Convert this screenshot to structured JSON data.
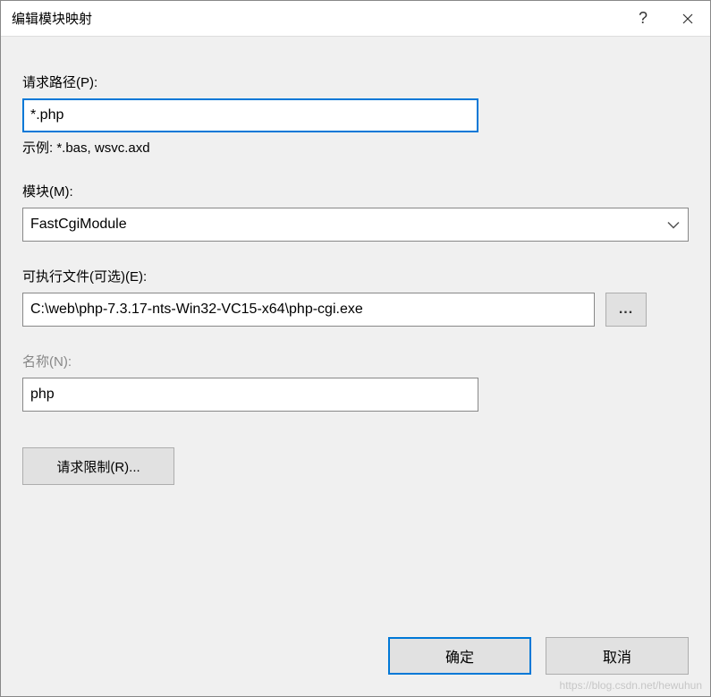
{
  "dialog": {
    "title": "编辑模块映射",
    "help_symbol": "?",
    "close_symbol": "✕"
  },
  "fields": {
    "request_path": {
      "label": "请求路径(P):",
      "value": "*.php",
      "hint": "示例: *.bas, wsvc.axd"
    },
    "module": {
      "label": "模块(M):",
      "value": "FastCgiModule"
    },
    "executable": {
      "label": "可执行文件(可选)(E):",
      "value": "C:\\web\\php-7.3.17-nts-Win32-VC15-x64\\php-cgi.exe",
      "browse_label": "..."
    },
    "name": {
      "label": "名称(N):",
      "value": "php"
    }
  },
  "buttons": {
    "restrict": "请求限制(R)...",
    "ok": "确定",
    "cancel": "取消"
  },
  "watermark": "https://blog.csdn.net/hewuhun"
}
